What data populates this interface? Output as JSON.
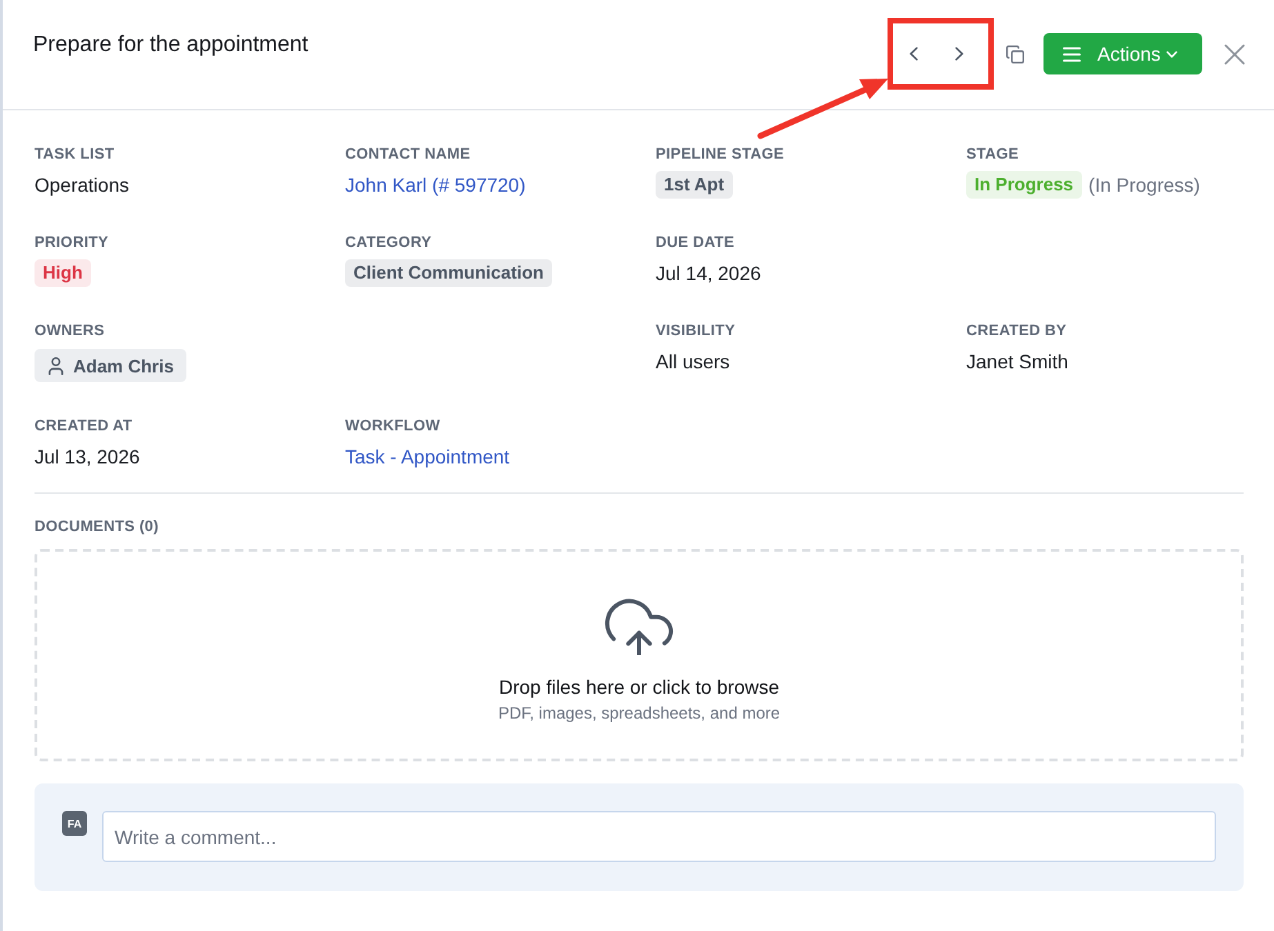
{
  "panel": {
    "title": "Prepare for the appointment",
    "actions_button": {
      "label": "Actions"
    }
  },
  "fields": [
    {
      "kind": "text",
      "label": "TASK LIST",
      "value": "Operations"
    },
    {
      "kind": "link",
      "label": "CONTACT NAME",
      "value": "John Karl (# 597720)"
    },
    {
      "kind": "badge",
      "label": "PIPELINE STAGE",
      "value": "1st Apt",
      "color": "#4b5563"
    },
    {
      "kind": "status",
      "label": "STAGE",
      "value": "In Progress",
      "color": "#4caf2e",
      "note": "(In Progress)"
    },
    {
      "kind": "badge",
      "label": "PRIORITY",
      "value": "High",
      "color": "#dc3545"
    },
    {
      "kind": "badge",
      "label": "CATEGORY",
      "value": "Client Communication",
      "color": "#4b5563"
    },
    {
      "kind": "text",
      "label": "DUE DATE",
      "value": "Jul 14, 2026"
    },
    {
      "kind": "blank"
    },
    {
      "kind": "person",
      "label": "OWNERS",
      "value": "Adam Chris"
    },
    {
      "kind": "blank"
    },
    {
      "kind": "text",
      "label": "VISIBILITY",
      "value": "All users"
    },
    {
      "kind": "text",
      "label": "CREATED BY",
      "value": "Janet Smith"
    },
    {
      "kind": "text",
      "label": "CREATED AT",
      "value": "Jul 13, 2026"
    },
    {
      "kind": "link",
      "label": "WORKFLOW",
      "value": "Task - Appointment"
    }
  ],
  "documents": {
    "label": "DOCUMENTS (0)",
    "dropzone": {
      "title": "Drop files here or click to browse",
      "hint": "PDF, images, spreadsheets, and more"
    }
  },
  "comment": {
    "avatar_initials": "FA",
    "placeholder": "Write a comment..."
  }
}
